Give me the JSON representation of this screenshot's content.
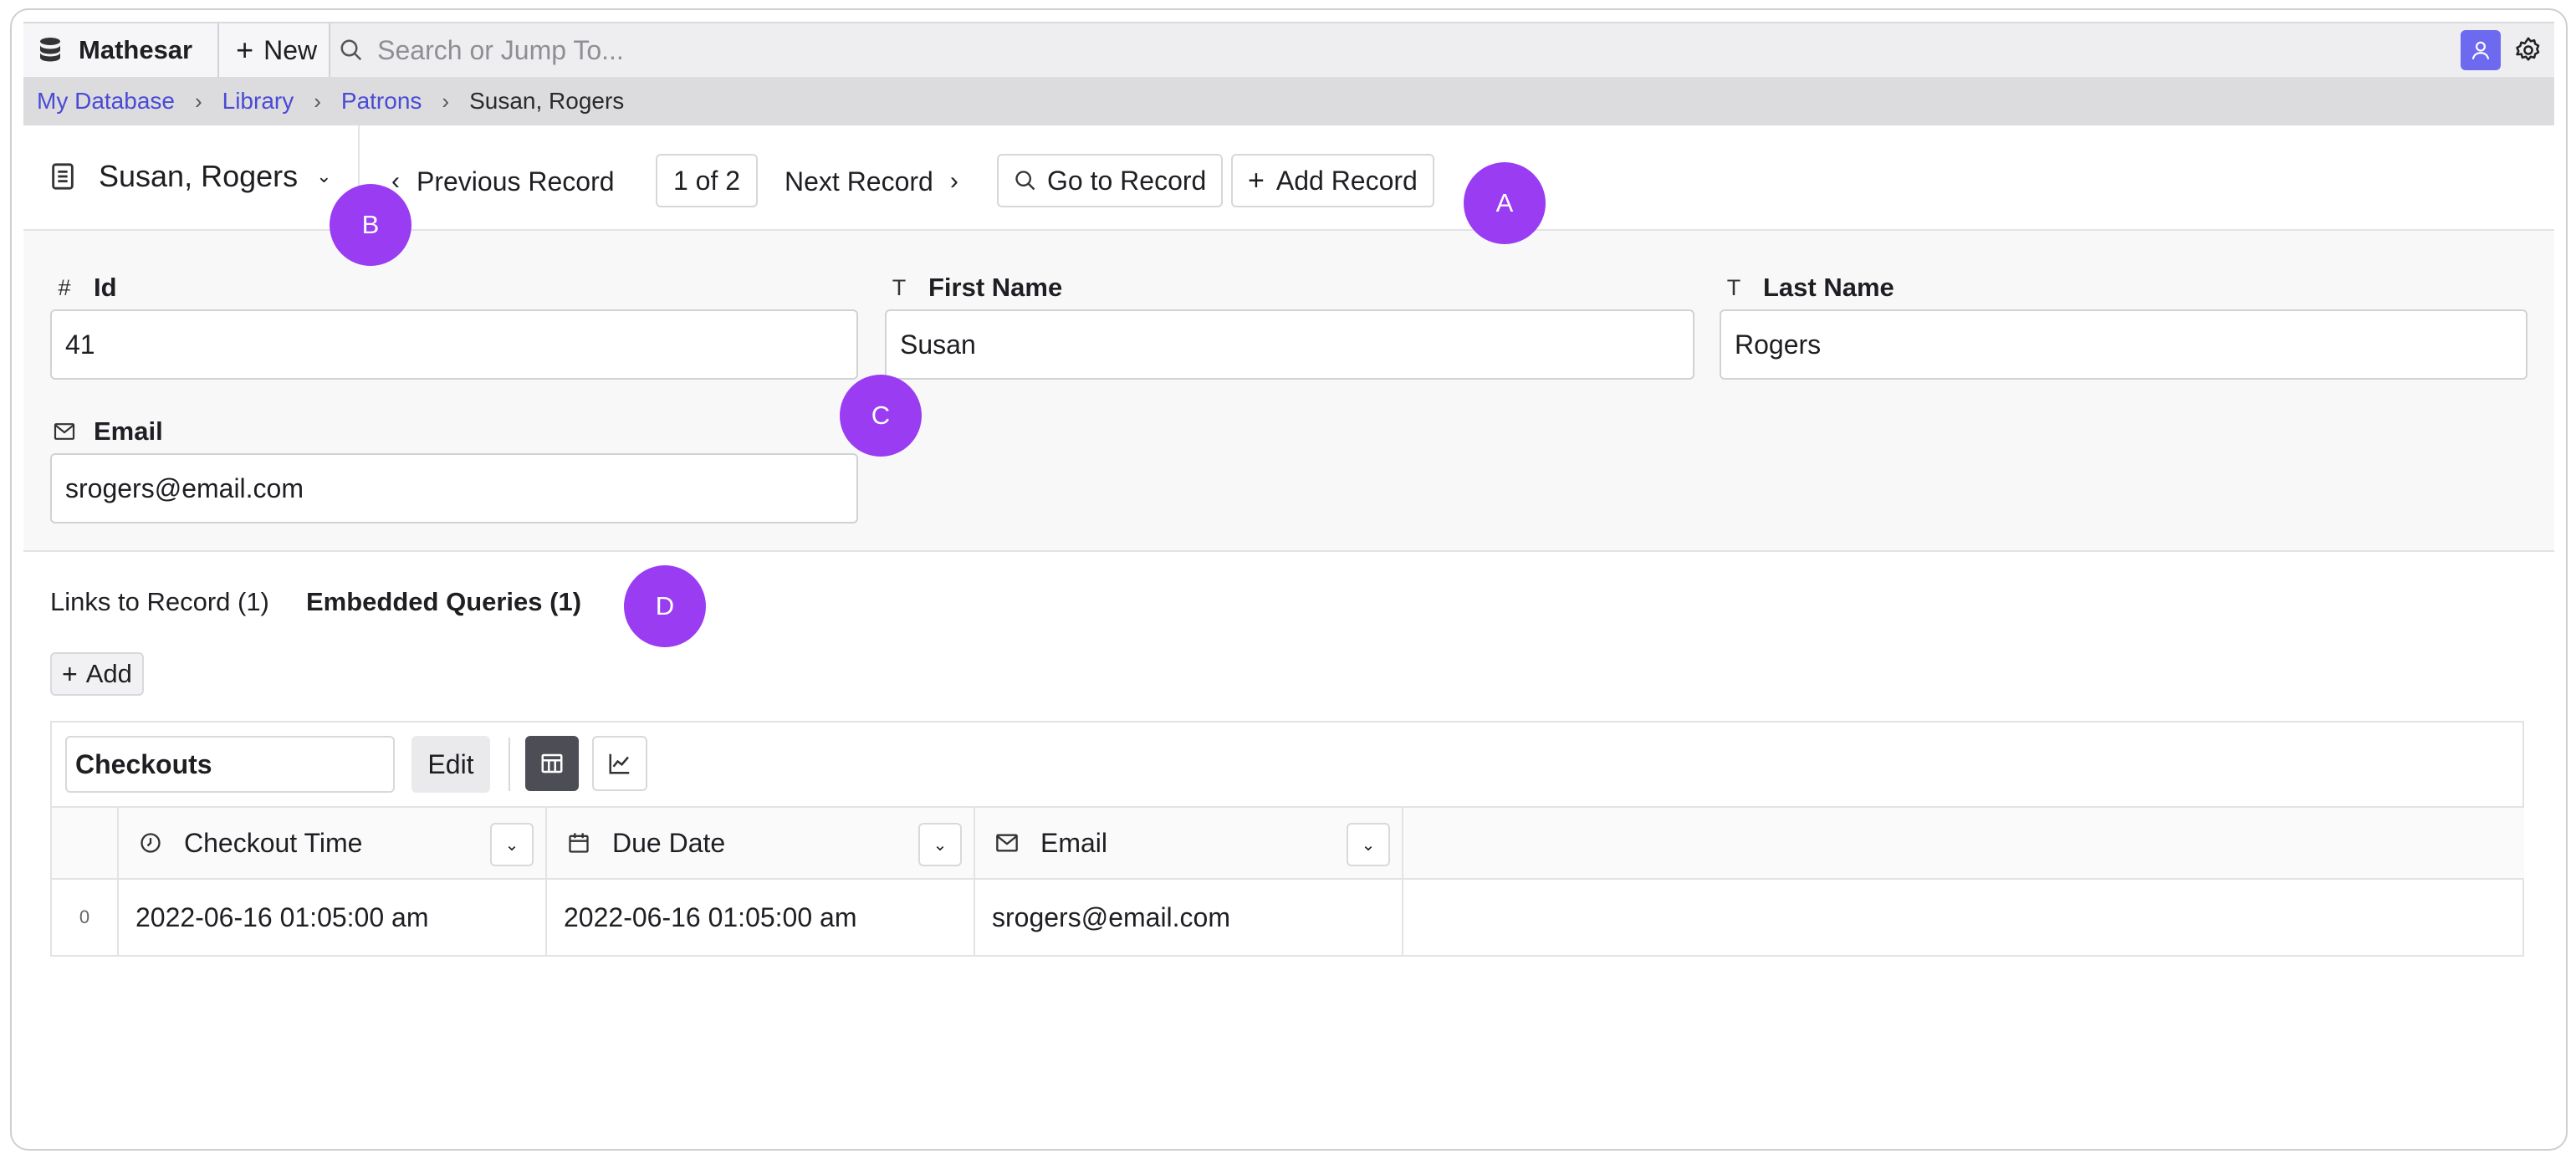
{
  "app": {
    "brand": "Mathesar",
    "new_label": "New",
    "search_placeholder": "Search or Jump To..."
  },
  "breadcrumb": {
    "database": "My Database",
    "schema": "Library",
    "table": "Patrons",
    "record": "Susan, Rogers"
  },
  "record_header": {
    "title": "Susan, Rogers",
    "previous_label": "Previous Record",
    "position": "1 of 2",
    "next_label": "Next Record",
    "goto_label": "Go to Record",
    "add_label": "Add Record"
  },
  "fields": [
    {
      "label": "Id",
      "type_icon": "#",
      "value": "41"
    },
    {
      "label": "First Name",
      "type_icon": "T",
      "value": "Susan"
    },
    {
      "label": "Last Name",
      "type_icon": "T",
      "value": "Rogers"
    },
    {
      "label": "Email",
      "type_icon": "mail-icon",
      "value": "srogers@email.com"
    }
  ],
  "tabs": [
    {
      "label": "Links to Record (1)",
      "active": false
    },
    {
      "label": "Embedded Queries (1)",
      "active": true
    }
  ],
  "add_label": "Add",
  "query": {
    "name": "Checkouts",
    "edit_label": "Edit",
    "columns": [
      {
        "label": "Checkout Time",
        "icon": "clock-icon"
      },
      {
        "label": "Due Date",
        "icon": "calendar-icon"
      },
      {
        "label": "Email",
        "icon": "mail-icon"
      }
    ],
    "rows": [
      {
        "index": "0",
        "cells": [
          "2022-06-16 01:05:00 am",
          "2022-06-16 01:05:00 am",
          "srogers@email.com"
        ]
      }
    ]
  },
  "markers": [
    "A",
    "B",
    "C",
    "D"
  ],
  "colors": {
    "accent": "#6d6af0",
    "marker": "#9a3cf2",
    "link": "#4a4ad6"
  }
}
